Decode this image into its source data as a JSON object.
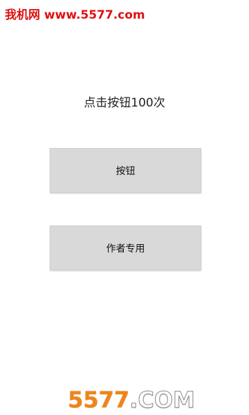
{
  "watermark_top": "我机网 www.5577.com",
  "prompt": "点击按钮100次",
  "buttons": {
    "main": "按钮",
    "author": "作者专用"
  },
  "watermark_bottom": {
    "number": "5577",
    "suffix": ".COM"
  },
  "colors": {
    "watermark_red": "#e01111",
    "watermark_orange": "#f08419",
    "button_bg": "#d9d9d9"
  }
}
